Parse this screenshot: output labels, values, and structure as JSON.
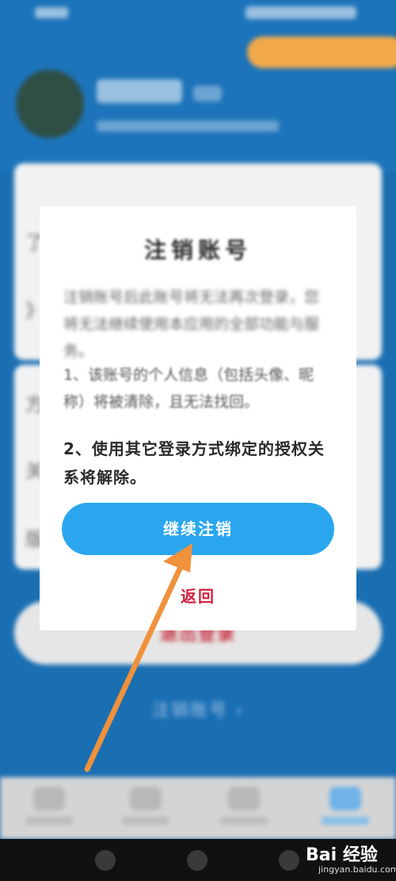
{
  "background": {
    "logout_label": "退出登录",
    "cancel_account_link": "注销账号 ›",
    "row_chars": [
      "了",
      "》",
      "方",
      "关",
      "版"
    ]
  },
  "dialog": {
    "title": "注销账号",
    "intro": "注销账号后此账号将无法再次登录，您将无法继续使用本应用的全部功能与服务。",
    "item1": "1、该账号的个人信息（包括头像、昵称）将被清除，且无法找回。",
    "item2": "2、使用其它登录方式绑定的授权关系将解除。",
    "continue_button": "继续注销",
    "back_link": "返回"
  },
  "watermark": {
    "brand": "Bai 经验",
    "site": "jingyan.baidu.com"
  },
  "colors": {
    "primary_blue": "#2aa6ee",
    "header_blue": "#1d74ba",
    "danger_red": "#d0213d",
    "annotation_arrow": "#f0913c"
  }
}
